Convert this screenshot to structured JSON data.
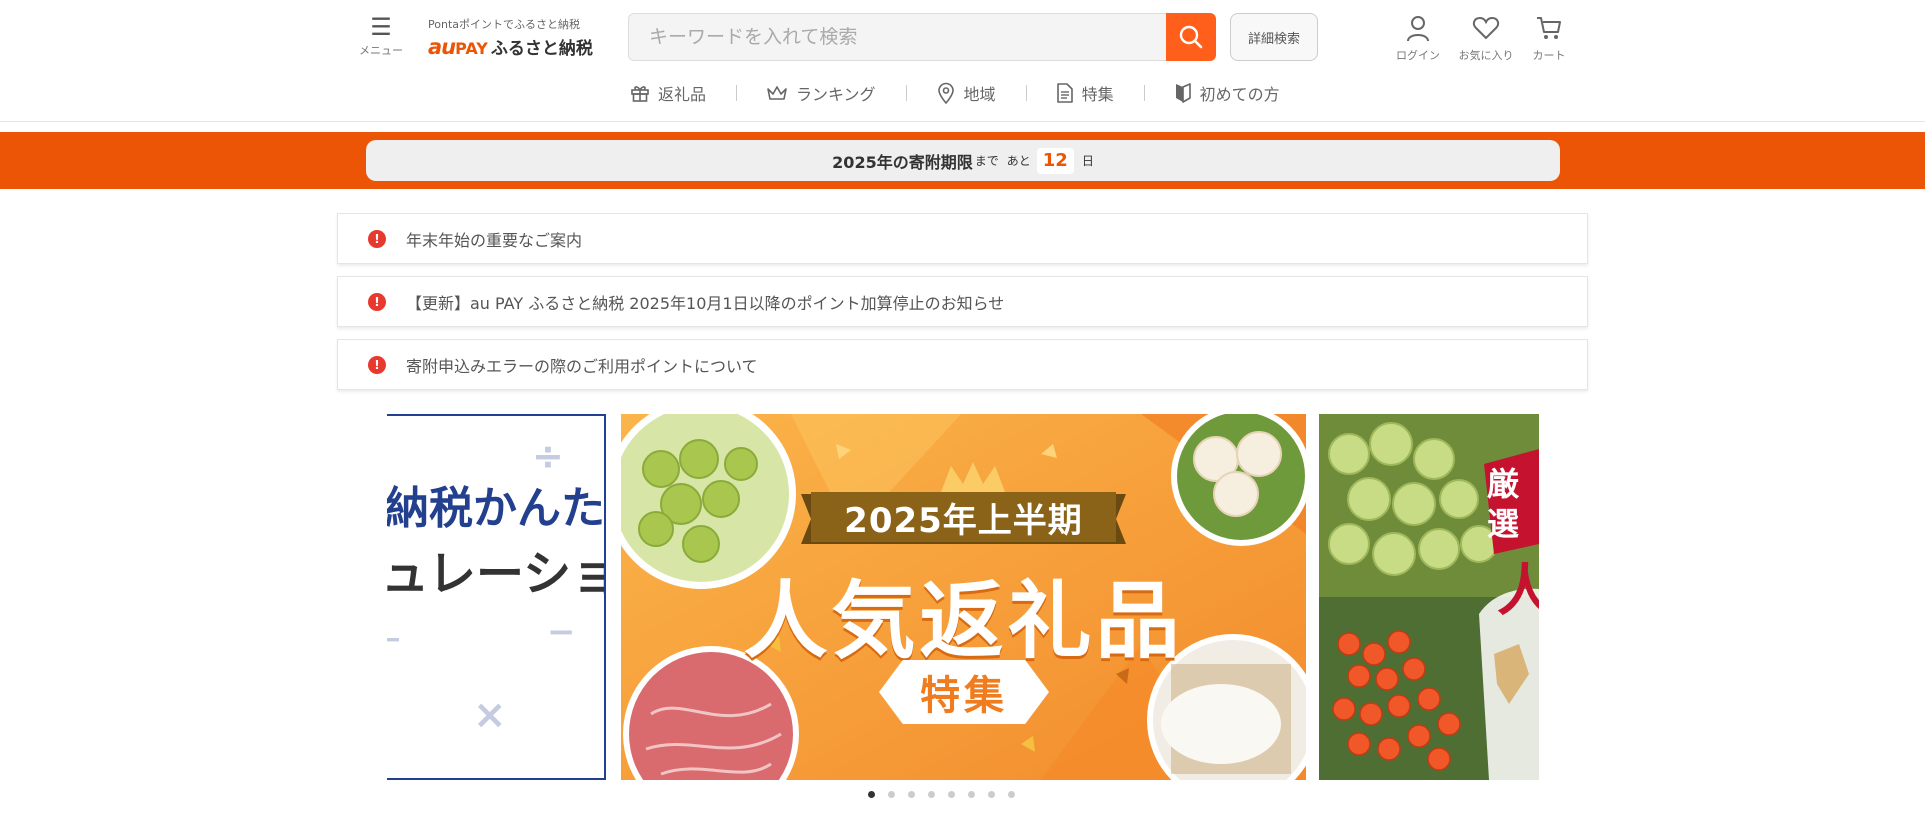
{
  "header": {
    "menu_label": "メニュー",
    "logo_tagline": "Pontaポイントでふるさと納税",
    "logo_au": "au",
    "logo_pay": "PAY",
    "logo_name": "ふるさと納税",
    "search_placeholder": "キーワードを入れて検索",
    "advanced_search_label": "詳細検索",
    "login_label": "ログイン",
    "favorites_label": "お気に入り",
    "cart_label": "カート"
  },
  "nav": [
    {
      "label": "返礼品",
      "icon": "gift-icon"
    },
    {
      "label": "ランキング",
      "icon": "crown-icon"
    },
    {
      "label": "地域",
      "icon": "location-pin-icon"
    },
    {
      "label": "特集",
      "icon": "document-icon"
    },
    {
      "label": "初めての方",
      "icon": "beginner-mark-icon"
    }
  ],
  "deadline": {
    "prefix": "2025年の寄附期限",
    "made": "まで",
    "ato": "あと",
    "days": "12",
    "unit": "日",
    "bar_color": "#eb5505"
  },
  "notices": [
    {
      "text": "年末年始の重要なご案内"
    },
    {
      "text": "【更新】au PAY ふるさと納税 2025年10月1日以降のポイント加算停止のお知らせ"
    },
    {
      "text": "寄附申込みエラーの際のご利用ポイントについて"
    }
  ],
  "banners": {
    "left": {
      "line1": "ふるさと納税かんたか計算",
      "line2": "シミュレーション"
    },
    "center": {
      "year_tag": "2025年上半期",
      "title": "人気返礼品",
      "badge": "特集"
    },
    "right": {
      "badge": "厳選",
      "title": "人"
    }
  },
  "carousel": {
    "slide_count": 8,
    "active_index": 0
  },
  "colors": {
    "accent": "#eb5505",
    "search_button": "#ff5f1a",
    "alert": "#e8392f"
  }
}
